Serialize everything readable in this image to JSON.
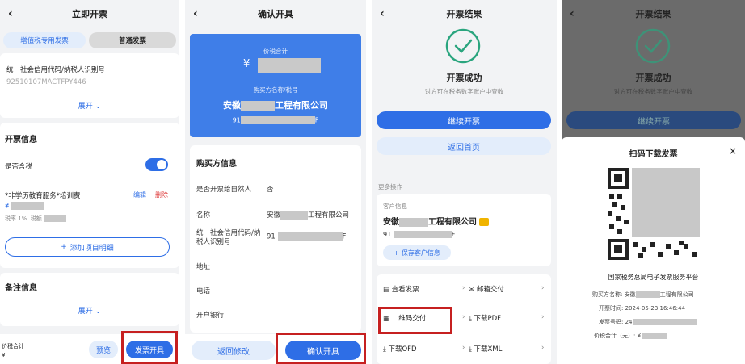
{
  "p1": {
    "title": "立即开票",
    "tab_special": "增值税专用发票",
    "tab_normal": "普通发票",
    "buyer_id_label": "统一社会信用代码/纳税人识别号",
    "buyer_id_value": "92510107MACTFPY446",
    "expand": "展开",
    "section_invoice": "开票信息",
    "tax_included_label": "是否含税",
    "item_name": "*非学历教育服务*培训费",
    "edit": "编辑",
    "delete": "删除",
    "yen": "¥",
    "tax_rate": "税率 1%",
    "tax_amount": "税额",
    "add_item": "添加项目明细",
    "section_remark": "备注信息",
    "expand2": "展开",
    "total_label": "价税合计",
    "total_yen": "¥",
    "preview": "预览",
    "issue": "发票开具"
  },
  "p2": {
    "title": "确认开具",
    "total_label": "价税合计",
    "yen": "¥",
    "buyer_label": "购买方名称/税号",
    "buyer_name_prefix": "安徽",
    "buyer_name_suffix": "工程有限公司",
    "tax_prefix": "91",
    "tax_suffix": "F",
    "section_buyer": "购买方信息",
    "natural_person_label": "是否开票给自然人",
    "natural_person_value": "否",
    "name_label": "名称",
    "name_prefix": "安徽",
    "name_suffix": "工程有限公司",
    "credit_label": "统一社会信用代码/纳税人识别号",
    "credit_prefix": "91",
    "credit_suffix": "F",
    "address_label": "地址",
    "phone_label": "电话",
    "bank_label": "开户银行",
    "back_edit": "返回修改",
    "confirm": "确认开具"
  },
  "p3": {
    "title": "开票结果",
    "success": "开票成功",
    "success_note": "对方可在税务数字账户中查收",
    "continue": "继续开票",
    "home": "返回首页",
    "more_ops": "更多操作",
    "customer_info": "客户信息",
    "cust_prefix": "安徽",
    "cust_suffix": "工程有限公司",
    "cust_tax_prefix": "91",
    "cust_tax_suffix": "F",
    "save_customer": "保存客户信息",
    "view_invoice": "查看发票",
    "email_deliver": "邮箱交付",
    "qr_deliver": "二维码交付",
    "download_pdf": "下载PDF",
    "download_ofd": "下载OFD",
    "download_xml": "下载XML"
  },
  "p4": {
    "title": "开票结果",
    "success": "开票成功",
    "success_note": "对方可在税务数字账户中查收",
    "continue": "继续开票",
    "sheet_title": "扫码下载发票",
    "close": "×",
    "platform": "国家税务总局电子发票服务平台",
    "buyer_label": "购买方名称:",
    "buyer_prefix": "安徽",
    "buyer_suffix": "工程有限公司",
    "time_label": "开票时间:",
    "time_value": "2024-05-23 16:46:44",
    "number_label": "发票号码:",
    "number_prefix": "24",
    "amount_label": "价税合计（元）: ¥"
  },
  "colors": {
    "primary": "#2e6ee6",
    "success": "#2aa57e",
    "highlight": "#c62020"
  }
}
